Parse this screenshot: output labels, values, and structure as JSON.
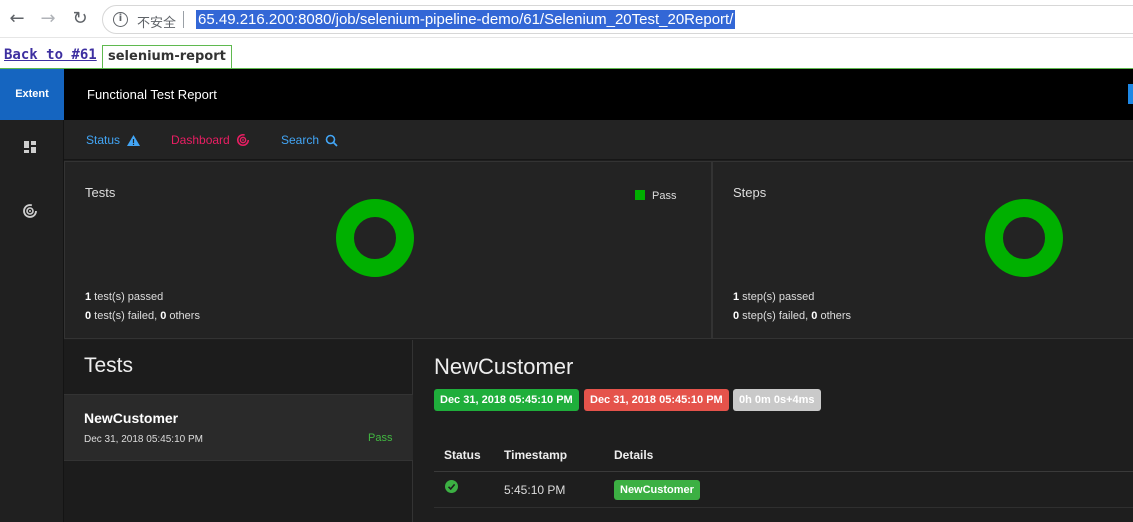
{
  "browser": {
    "security_label": "不安全",
    "url": "65.49.216.200:8080/job/selenium-pipeline-demo/61/Selenium_20Test_20Report/"
  },
  "jenkins": {
    "back_link": "Back to #61",
    "report_tab": "selenium-report"
  },
  "sidebar": {
    "logo": "Extent",
    "icons": [
      "dashboard-grid-icon",
      "radar-icon"
    ]
  },
  "header": {
    "title": "Functional Test Report"
  },
  "subnav": {
    "status": "Status",
    "dashboard": "Dashboard",
    "search": "Search"
  },
  "tests_card": {
    "title": "Tests",
    "legend": "Pass",
    "passed_count": "1",
    "passed_text": " test(s) passed",
    "failed_count": "0",
    "failed_text": " test(s) failed, ",
    "others_count": "0",
    "others_text": " others",
    "pass_fraction": 1.0
  },
  "steps_card": {
    "title": "Steps",
    "passed_count": "1",
    "passed_text": " step(s) passed",
    "failed_count": "0",
    "failed_text": " step(s) failed, ",
    "others_count": "0",
    "others_text": " others",
    "pass_fraction": 1.0
  },
  "tests_list": {
    "heading": "Tests",
    "items": [
      {
        "name": "NewCustomer",
        "time": "Dec 31, 2018 05:45:10 PM",
        "status": "Pass"
      }
    ]
  },
  "test_detail": {
    "name": "NewCustomer",
    "start": "Dec 31, 2018 05:45:10 PM",
    "end": "Dec 31, 2018 05:45:10 PM",
    "duration": "0h 0m 0s+4ms",
    "columns": [
      "Status",
      "Timestamp",
      "Details"
    ],
    "steps": [
      {
        "status_icon": "check-circle-icon",
        "timestamp": "5:45:10 PM",
        "details": "NewCustomer"
      }
    ]
  },
  "colors": {
    "pass": "#00b000",
    "accent": "#1565c0",
    "fail": "#e5534b",
    "dashboard": "#e91e63"
  }
}
